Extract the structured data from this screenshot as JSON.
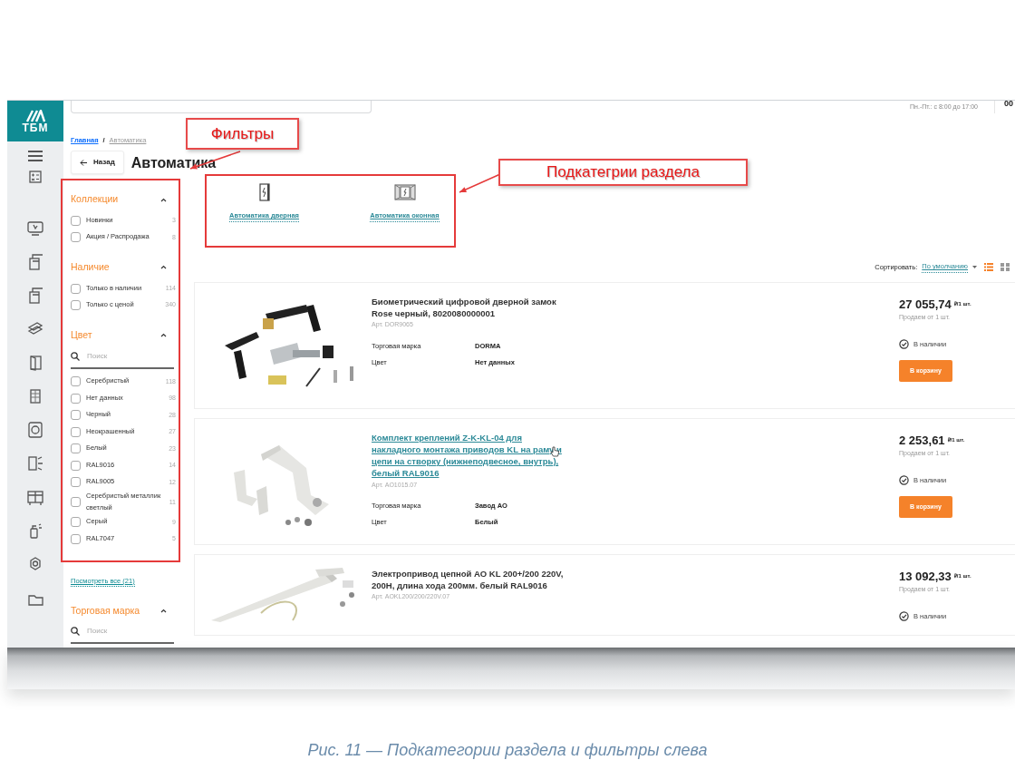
{
  "header": {
    "hours": "Пн.-Пт.: с 8:00 до 17:00",
    "phone_partial": "00"
  },
  "logo": {
    "text": "ТБМ"
  },
  "breadcrumb": [
    "Главная",
    "Автоматика"
  ],
  "breadcrumb_separator": "/",
  "back_button": "Назад",
  "page_title": "Автоматика",
  "filters": [
    {
      "title": "Коллекции",
      "expanded": true,
      "items": [
        {
          "label": "Новинки",
          "count": "3",
          "checked": false
        },
        {
          "label": "Акция / Распродажа",
          "count": "8",
          "checked": false
        }
      ]
    },
    {
      "title": "Наличие",
      "expanded": true,
      "items": [
        {
          "label": "Только в наличии",
          "count": "114",
          "checked": false
        },
        {
          "label": "Только с ценой",
          "count": "340",
          "checked": false
        }
      ]
    },
    {
      "title": "Цвет",
      "expanded": true,
      "search_placeholder": "Поиск",
      "items": [
        {
          "label": "Серебристый",
          "count": "118",
          "checked": false
        },
        {
          "label": "Нет данных",
          "count": "98",
          "checked": false
        },
        {
          "label": "Черный",
          "count": "28",
          "checked": false
        },
        {
          "label": "Неокрашенный",
          "count": "27",
          "checked": false
        },
        {
          "label": "Белый",
          "count": "23",
          "checked": false
        },
        {
          "label": "RAL9016",
          "count": "14",
          "checked": false
        },
        {
          "label": "RAL9005",
          "count": "12",
          "checked": false
        },
        {
          "label": "Серебристый металлик светлый",
          "count": "11",
          "checked": false
        },
        {
          "label": "Серый",
          "count": "9",
          "checked": false
        },
        {
          "label": "RAL7047",
          "count": "5",
          "checked": false
        }
      ],
      "show_all": "Посмотреть все (21)"
    },
    {
      "title": "Торговая марка",
      "expanded": true,
      "search_placeholder": "Поиск"
    }
  ],
  "subcategories": [
    {
      "label": "Автоматика дверная",
      "kind": "door"
    },
    {
      "label": "Автоматика оконная",
      "kind": "window"
    }
  ],
  "sort": {
    "label": "Сортировать:",
    "value": "По умолчанию",
    "view_modes": [
      {
        "kind": "list",
        "selected": true
      },
      {
        "kind": "grid",
        "selected": false
      }
    ]
  },
  "products": [
    {
      "name": "Биометрический цифровой дверной замок Rose черный, 8020080000001",
      "link": false,
      "article": "Арт. DOR9065",
      "props": [
        {
          "label": "Торговая марка",
          "value": "DORMA"
        },
        {
          "label": "Цвет",
          "value": "Нет данных"
        }
      ],
      "price": "27 055,74",
      "unit": "₽/1 шт.",
      "min_order": "Продаем от 1 шт.",
      "stock": "В наличии",
      "cart_button": "В корзину"
    },
    {
      "name": "Комплект креплений Z-K-KL-04 для накладного монтажа приводов KL на раму и цепи на створку (нижнеподвесное, внутрь), белый RAL9016",
      "link": true,
      "article": "Арт. AO1015.07",
      "props": [
        {
          "label": "Торговая марка",
          "value": "Завод АО"
        },
        {
          "label": "Цвет",
          "value": "Белый"
        }
      ],
      "price": "2 253,61",
      "unit": "₽/1 шт.",
      "min_order": "Продаем от 1 шт.",
      "stock": "В наличии",
      "cart_button": "В корзину"
    },
    {
      "name": "Электропривод цепной АО KL 200+/200 220V, 200Н, длина хода 200мм. белый RAL9016",
      "link": false,
      "article": "Арт. AOKL200/200/220V.07",
      "price": "13 092,33",
      "unit": "₽/1 шт.",
      "min_order": "Продаем от 1 шт.",
      "stock": "В наличии"
    }
  ],
  "annotations": [
    {
      "text": "Фильтры"
    },
    {
      "text": "Подкатегрии раздела"
    }
  ],
  "caption": "Рис. 11 — Подкатегории раздела и фильтры слева"
}
